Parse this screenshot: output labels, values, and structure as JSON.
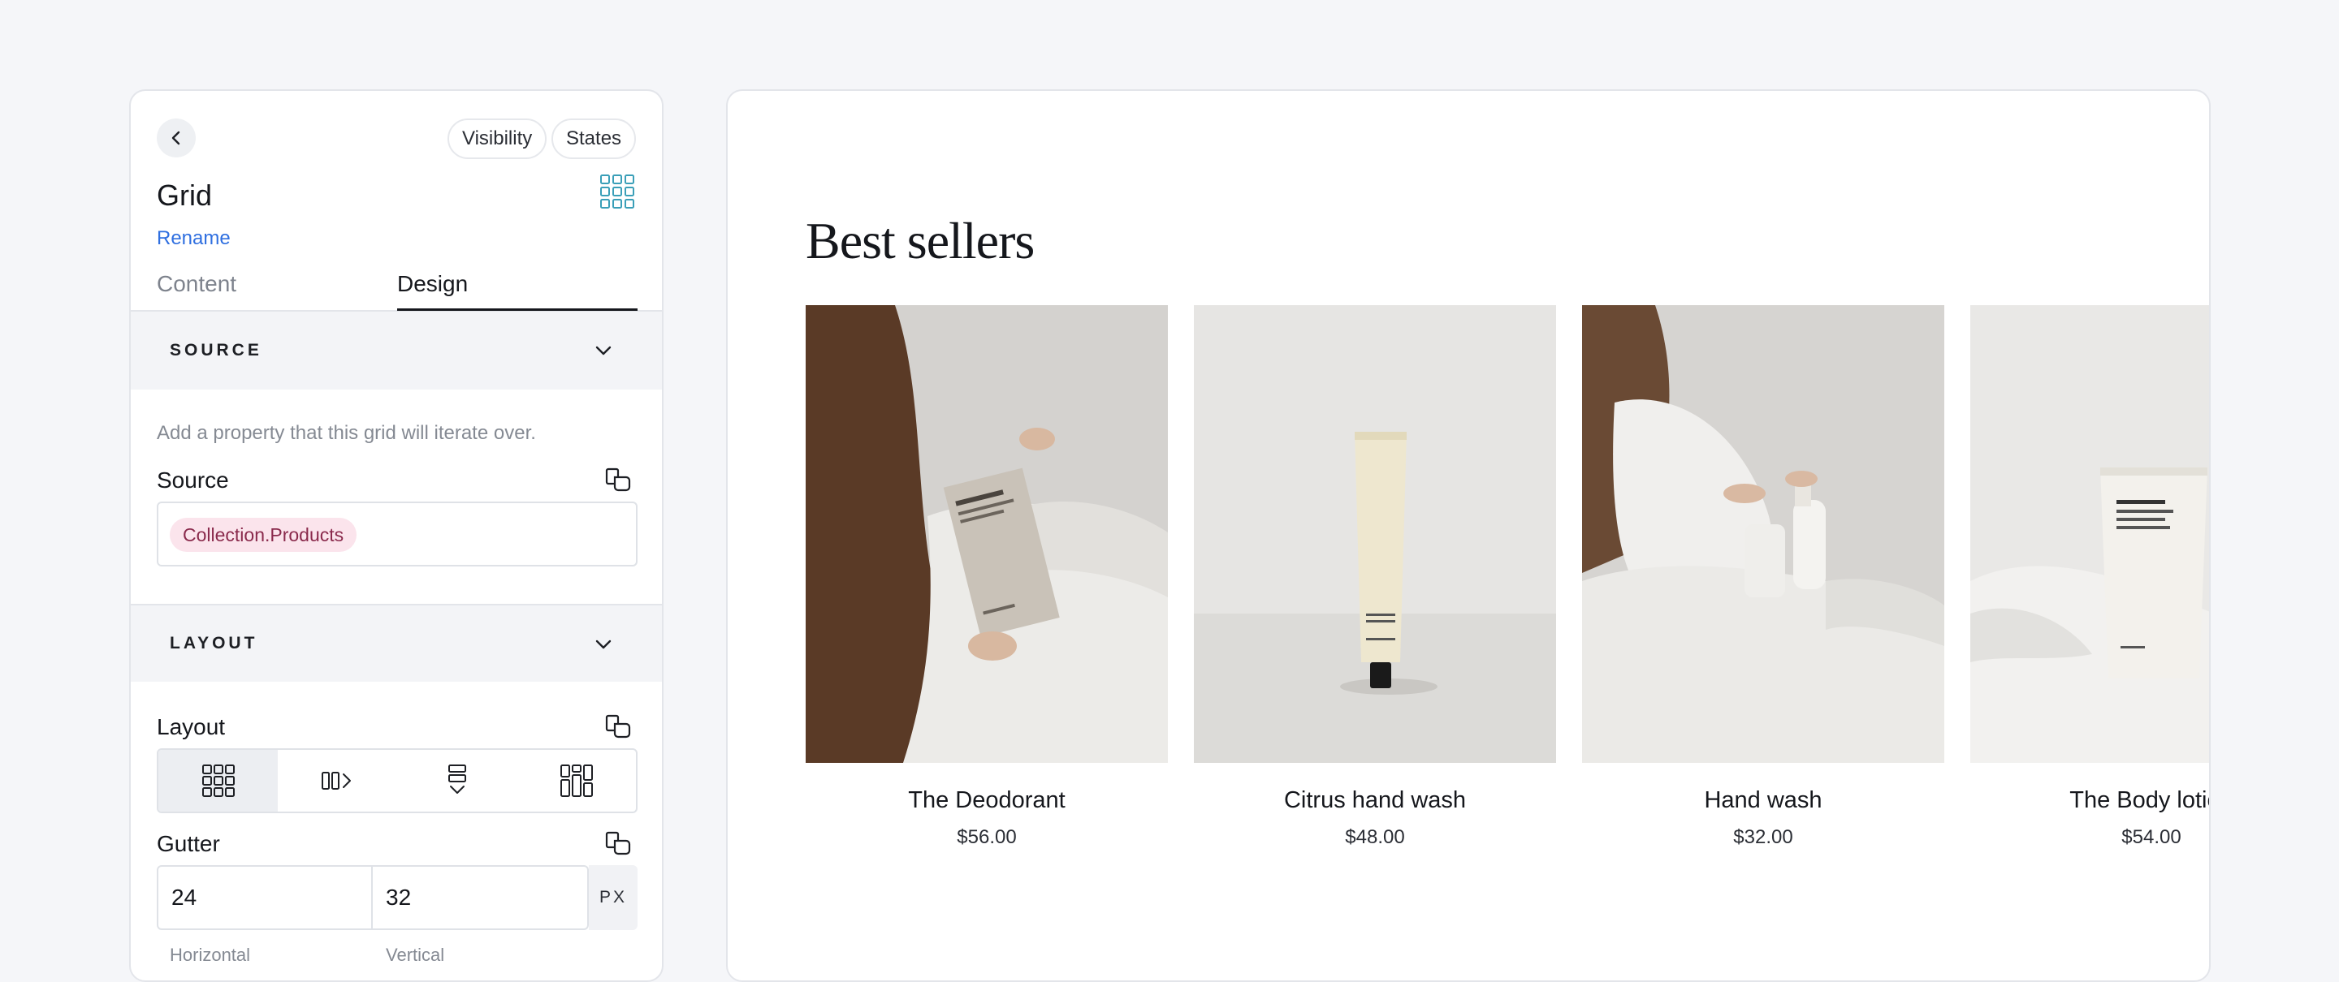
{
  "panel": {
    "pills": {
      "visibility": "Visibility",
      "states": "States"
    },
    "title": "Grid",
    "rename": "Rename",
    "tabs": {
      "content": "Content",
      "design": "Design"
    },
    "source_section": {
      "header": "SOURCE",
      "hint": "Add a property that this grid will iterate over.",
      "field_label": "Source",
      "value_chip": "Collection.Products"
    },
    "layout_section": {
      "header": "LAYOUT",
      "layout_label": "Layout",
      "gutter_label": "Gutter",
      "gutter_horizontal": "24",
      "gutter_vertical": "32",
      "gutter_unit": "PX",
      "sub_labels": {
        "horizontal": "Horizontal",
        "vertical": "Vertical"
      }
    }
  },
  "preview": {
    "heading": "Best sellers",
    "products": [
      {
        "name": "The Deodorant",
        "price": "$56.00"
      },
      {
        "name": "Citrus hand wash",
        "price": "$48.00"
      },
      {
        "name": "Hand wash",
        "price": "$32.00"
      },
      {
        "name": "The Body lotion",
        "price": "$54.00"
      }
    ]
  },
  "icons": [
    "chevron-left-icon",
    "grid-icon",
    "chevron-down-icon",
    "binding-icon",
    "grid-layout-icon",
    "carousel-layout-icon",
    "stack-layout-icon",
    "masonry-layout-icon"
  ],
  "colors": {
    "accent_blue": "#2f6fe0",
    "grid_icon_teal": "#3a9fb8",
    "chip_bg": "#fbe4ec",
    "chip_text": "#8a2a4c"
  }
}
